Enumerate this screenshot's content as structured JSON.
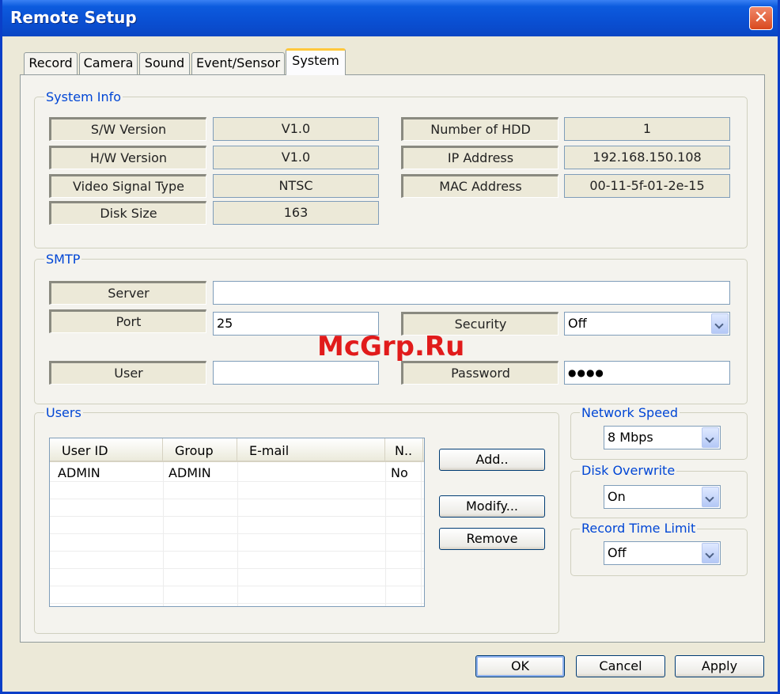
{
  "window": {
    "title": "Remote Setup",
    "close_glyph": "✕"
  },
  "tabs": [
    "Record",
    "Camera",
    "Sound",
    "Event/Sensor",
    "System"
  ],
  "system_info": {
    "legend": "System Info",
    "sw_version_label": "S/W Version",
    "sw_version": "V1.0",
    "hw_version_label": "H/W Version",
    "hw_version": "V1.0",
    "video_signal_label": "Video Signal Type",
    "video_signal": "NTSC",
    "disk_size_label": "Disk Size",
    "disk_size": "163",
    "hdd_count_label": "Number of HDD",
    "hdd_count": "1",
    "ip_label": "IP Address",
    "ip": "192.168.150.108",
    "mac_label": "MAC Address",
    "mac": "00-11-5f-01-2e-15"
  },
  "smtp": {
    "legend": "SMTP",
    "server_label": "Server",
    "server": "",
    "port_label": "Port",
    "port": "25",
    "security_label": "Security",
    "security": "Off",
    "user_label": "User",
    "user": "",
    "password_label": "Password",
    "password": "●●●●"
  },
  "users": {
    "legend": "Users",
    "columns": [
      "User ID",
      "Group",
      "E-mail",
      "N.."
    ],
    "rows": [
      [
        "ADMIN",
        "ADMIN",
        "",
        "No"
      ]
    ],
    "add_label": "Add..",
    "modify_label": "Modify...",
    "remove_label": "Remove"
  },
  "network_speed": {
    "legend": "Network Speed",
    "value": "8 Mbps"
  },
  "disk_overwrite": {
    "legend": "Disk Overwrite",
    "value": "On"
  },
  "record_time_limit": {
    "legend": "Record Time Limit",
    "value": "Off"
  },
  "footer": {
    "ok": "OK",
    "cancel": "Cancel",
    "apply": "Apply"
  },
  "watermark": "McGrp.Ru",
  "colors": {
    "titlebar": "#0a4fd2",
    "dialog_bg": "#ece9d8",
    "legend_text": "#0046d5",
    "active_tab_accent": "#ffc83c"
  }
}
